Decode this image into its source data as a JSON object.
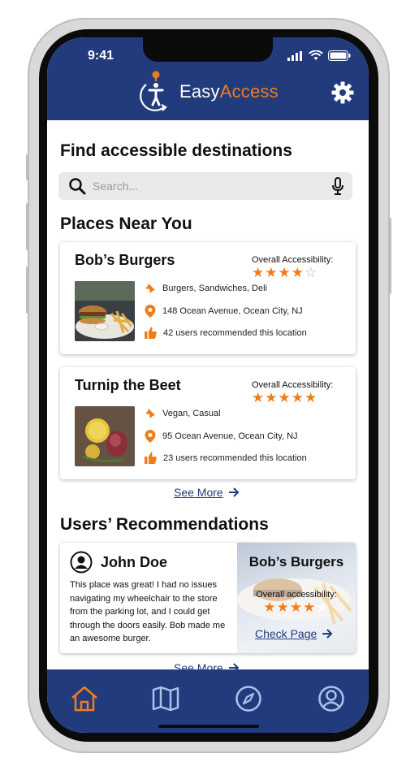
{
  "status_bar": {
    "time": "9:41"
  },
  "header": {
    "logo_part1": "Easy",
    "logo_part2": "Access",
    "settings_icon": "gear-icon"
  },
  "colors": {
    "brand_blue": "#213b7d",
    "accent_orange": "#f07d1c"
  },
  "main": {
    "find_heading": "Find accessible destinations",
    "search": {
      "placeholder": "Search...",
      "value": ""
    },
    "places_heading": "Places Near You",
    "places": [
      {
        "name": "Bob’s Burgers",
        "accessibility_label": "Overall Accessibility:",
        "rating": 4,
        "rating_max": 5,
        "categories": "Burgers, Sandwiches, Deli",
        "address": "148 Ocean Avenue, Ocean City, NJ",
        "recommendations": "42 users recommended this location"
      },
      {
        "name": "Turnip the Beet",
        "accessibility_label": "Overall Accessibility:",
        "rating": 5,
        "rating_max": 5,
        "categories": "Vegan, Casual",
        "address": "95 Ocean Avenue, Ocean City, NJ",
        "recommendations": "23 users recommended this location"
      }
    ],
    "see_more_label": "See More",
    "recommendations_heading": "Users’ Recommendations",
    "recommendation": {
      "user": "John Doe",
      "text": "This place was great! I had no issues navigating my wheelchair to the store from the parking lot, and I could get through the doors easily. Bob made me an awesome burger.",
      "place": "Bob’s Burgers",
      "accessibility_label": "Overall accessibility:",
      "rating": 4,
      "rating_max": 5,
      "check_page_label": "Check Page"
    },
    "see_more_label_2": "See More"
  },
  "tabbar": {
    "tabs": [
      {
        "icon": "home-icon",
        "active": true
      },
      {
        "icon": "map-icon",
        "active": false
      },
      {
        "icon": "compass-icon",
        "active": false
      },
      {
        "icon": "profile-icon",
        "active": false
      }
    ]
  }
}
